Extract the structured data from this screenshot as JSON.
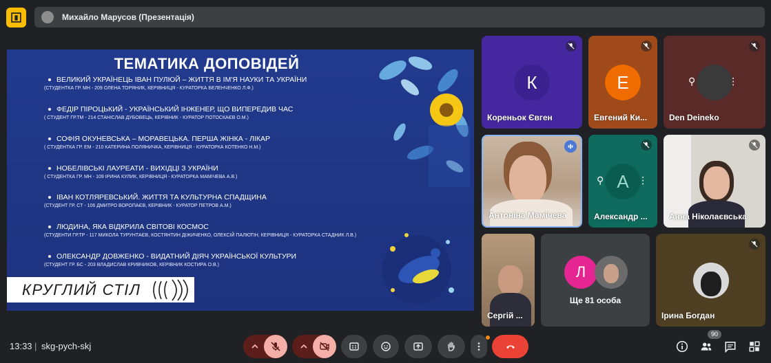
{
  "presenter": {
    "name": "Михайло Марусов (Презентація)"
  },
  "slide": {
    "title": "ТЕМАТИКА ДОПОВІДЕЙ",
    "topics": [
      {
        "title": "ВЕЛИКИЙ УКРАЇНЕЦЬ ІВАН ПУЛЮЙ – ЖИТТЯ В ІМ'Я НАУКИ ТА УКРАЇНИ",
        "authors": "(СТУДЕНТКА ГР. МН - 209 ОЛЕНА ТОРЯНИК, КЕРІВНИЦЯ - КУРАТОРКА БЕЛЕНЧЕНКО Л.Ф.)"
      },
      {
        "title": "ФЕДІР ПІРОЦЬКИЙ - УКРАЇНСЬКИЙ ІНЖЕНЕР, ЩО ВИПЕРЕДИВ ЧАС",
        "authors": "( СТУДЕНТ ГР.ТМ - 214 СТАНІСЛАВ ДУБОВЕЦЬ, КЕРІВНИК - КУРАТОР ПОТОСКАЄВ О.М.)"
      },
      {
        "title": "СОФІЯ ОКУНЕВСЬКА – МОРАВЕЦЬКА. ПЕРША ЖІНКА - ЛІКАР",
        "authors": "( СТУДЕНТКА ГР. ЕМ - 210 КАТЕРИНА ПОЛЯНИЧКА, КЕРІВНИЦЯ - КУРАТОРКА КОТЕНКО Н.М.)"
      },
      {
        "title": "НОБЕЛІВСЬКІ ЛАУРЕАТИ - ВИХІДЦІ З УКРАЇНИ",
        "authors": "( СТУДЕНТКА ГР. МН - 109 ІРИНА КУЛИК, КЕРІВНИЦЯ - КУРАТОРКА МАМІЧЕВА А.В.)"
      },
      {
        "title": "ІВАН КОТЛЯРЕВСЬКИЙ. ЖИТТЯ ТА КУЛЬТУРНА СПАДЩИНА",
        "authors": "(СТУДЕНТ ГР. СТ - 106 ДМИТРО ВОРОПАЄВ, КЕРІВНИК - КУРАТОР ПЕТРОВ А.М.)"
      },
      {
        "title": "ЛЮДИНА, ЯКА ВІДКРИЛА СВІТОВІ КОСМОС",
        "authors": "(СТУДЕНТИ ГР.ТР - 117 МИКОЛА ТУРУНТАЄВ, КОСТЯНТИН ДІЖИЧЕНКО, ОЛЕКСІЙ ПАЛЮТІН, КЕРІВНИЦЯ - КУРАТОРКА СТАДНИК Л.В.)"
      },
      {
        "title": "ОЛЕКСАНДР ДОВЖЕНКО - ВИДАТНИЙ ДІЯЧ УКРАЇНСЬКОЇ КУЛЬТУРИ",
        "authors": "(СТУДЕНТ ГР. БС - 203 ВЛАДИСЛАВ КРИВЧИКОВ, КЕРІВНИК КОСТИРА О.В.)"
      }
    ],
    "banner": "КРУГЛИЙ СТІЛ"
  },
  "participants": {
    "p1": {
      "name": "Кореньок Євген",
      "initial": "К"
    },
    "p2": {
      "name": "Евгений Ки...",
      "initial": "Е"
    },
    "p3": {
      "name": "Den Deineko",
      "initial": ""
    },
    "p4": {
      "name": "Антоніна Мамічева"
    },
    "p5": {
      "name": "Александр ...",
      "initial": "А"
    },
    "p6": {
      "name": "Анна Ніколаєвська"
    },
    "p7": {
      "name": "Сергій ..."
    },
    "others": {
      "label": "Ще 81 особа",
      "initial": "Л"
    },
    "p9": {
      "name": "Ірина Богдан"
    }
  },
  "bottom_bar": {
    "time": "13:33",
    "separator": "|",
    "meeting_code": "skg-pych-skj",
    "people_count": "90"
  },
  "colors": {
    "background": "#202124",
    "slide_blue": "#223a8e",
    "end_call": "#ea4335",
    "logo_yellow": "#fbbc04"
  },
  "icons": [
    "meeting-logo-icon",
    "mic-off-icon",
    "camera-off-icon",
    "captions-icon",
    "emoji-icon",
    "present-icon",
    "raise-hand-icon",
    "more-options-icon",
    "end-call-icon",
    "info-icon",
    "people-icon",
    "chat-icon",
    "activities-icon"
  ]
}
